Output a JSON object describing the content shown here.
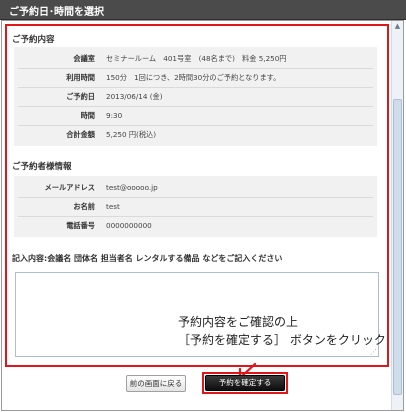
{
  "header": {
    "title": "ご予約日･時間を選択"
  },
  "reservation": {
    "heading": "ご予約内容",
    "rows": [
      {
        "label": "会議室",
        "value": "セミナールーム　401号室　(48名まで)　料金 5,250円"
      },
      {
        "label": "利用時間",
        "value": "150分　1回につき、2時間30分のご予約となります。"
      },
      {
        "label": "ご予約日",
        "value": "2013/06/14 (金)"
      },
      {
        "label": "時間",
        "value": "9:30"
      },
      {
        "label": "合計金額",
        "value": "5,250 円(税込)"
      }
    ]
  },
  "booker": {
    "heading": "ご予約者様情報",
    "rows": [
      {
        "label": "メールアドレス",
        "value": "test@ooooo.jp"
      },
      {
        "label": "お名前",
        "value": "test"
      },
      {
        "label": "電話番号",
        "value": "0000000000"
      }
    ]
  },
  "comments": {
    "label": "記入内容:会議名  団体名  担当者名  レンタルする備品 などをご記入ください",
    "value": ""
  },
  "annotation": {
    "line1": "予約内容をご確認の上",
    "line2": "［予約を確定する］ ボタンをクリック"
  },
  "buttons": {
    "back": "前の画面に戻る",
    "confirm": "予約を確定する"
  },
  "colors": {
    "highlight": "#e0161a",
    "titlebar": "#4b4b4b",
    "panel": "#f1f1f1"
  }
}
